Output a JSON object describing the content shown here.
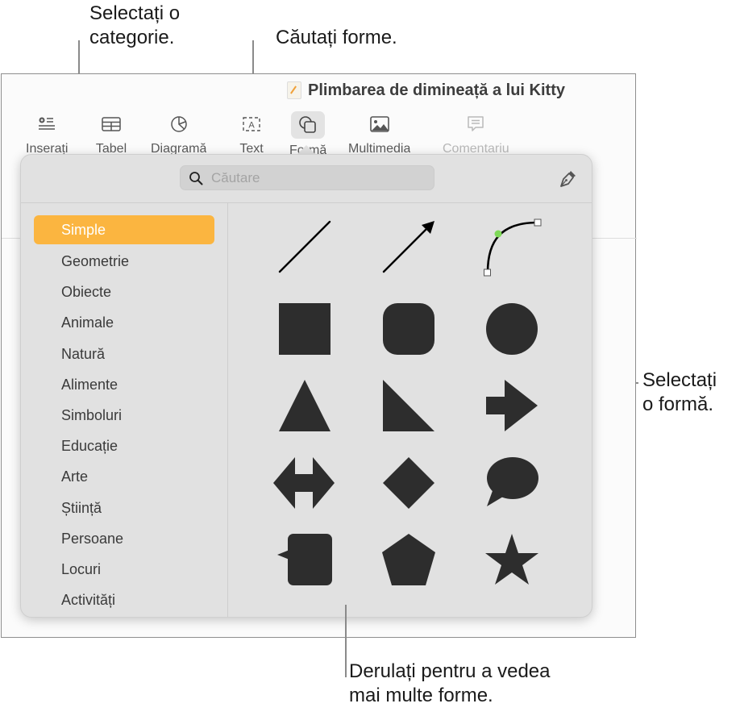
{
  "callouts": {
    "category": [
      "Selectați o",
      "categorie."
    ],
    "search": "Căutați forme.",
    "shape": [
      "Selectați",
      "o formă."
    ],
    "scroll": [
      "Derulați pentru a vedea",
      "mai multe forme."
    ]
  },
  "document": {
    "title": "Plimbarea de dimineață a lui Kitty",
    "icon": "pages-document-icon"
  },
  "toolbar": {
    "items": [
      {
        "label": "Inserați",
        "icon": "insert-icon",
        "enabled": true
      },
      {
        "label": "Tabel",
        "icon": "table-icon",
        "enabled": true
      },
      {
        "label": "Diagramă",
        "icon": "chart-icon",
        "enabled": true
      },
      {
        "label": "Text",
        "icon": "text-box-icon",
        "enabled": true
      },
      {
        "label": "Formă",
        "icon": "shape-icon",
        "enabled": true,
        "active": true
      },
      {
        "label": "Multimedia",
        "icon": "media-icon",
        "enabled": true
      },
      {
        "label": "Comentariu",
        "icon": "comment-icon",
        "enabled": false
      }
    ]
  },
  "shapes_popover": {
    "search": {
      "placeholder": "Căutare",
      "value": ""
    },
    "draw_tool_icon": "pen-icon",
    "selected_category": "Simple",
    "categories": [
      "Simple",
      "Geometrie",
      "Obiecte",
      "Animale",
      "Natură",
      "Alimente",
      "Simboluri",
      "Educație",
      "Arte",
      "Știință",
      "Persoane",
      "Locuri",
      "Activități"
    ],
    "shapes": [
      "line",
      "arrow-line",
      "curve",
      "square",
      "rounded-square",
      "circle",
      "triangle",
      "right-triangle",
      "arrow-right",
      "double-arrow",
      "diamond",
      "speech-bubble",
      "callout-square",
      "pentagon",
      "star"
    ],
    "curve_handle_color": "#7ed957",
    "accent_color": "#fbb540",
    "shape_fill_color": "#2d2d2d"
  }
}
